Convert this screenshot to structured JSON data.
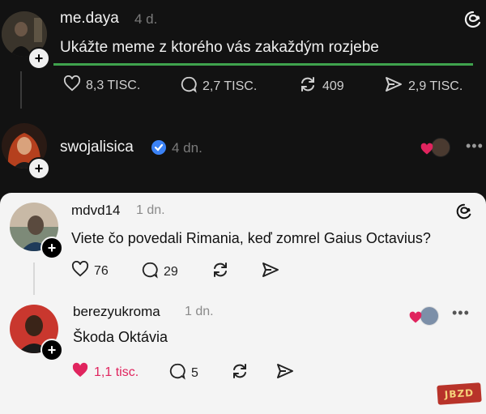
{
  "post": {
    "username": "me.daya",
    "time": "4 d.",
    "text": "Ukážte meme z ktorého vás zakaždým rozjebe",
    "likes": "8,3 TISC.",
    "replies": "2,7 TISC.",
    "reposts": "409",
    "shares": "2,9 TISC."
  },
  "reply": {
    "username": "swojalisica",
    "time": "4 dn."
  },
  "embedded": {
    "post": {
      "username": "mdvd14",
      "time": "1 dn.",
      "text": "Viete čo povedali Rimania, keď zomrel Gaius Octavius?",
      "likes": "76",
      "replies": "29"
    },
    "reply": {
      "username": "berezyukroma",
      "time": "1 dn.",
      "text": "Škoda Oktávia",
      "likes": "1,1 tisc.",
      "replies": "5"
    }
  },
  "watermark": "JBZD",
  "colors": {
    "dark_bg": "#121212",
    "light_bg": "#f4f4f4",
    "verified": "#3b82f6",
    "like_red": "#e0245e",
    "highlight_green": "#3fa34d"
  }
}
